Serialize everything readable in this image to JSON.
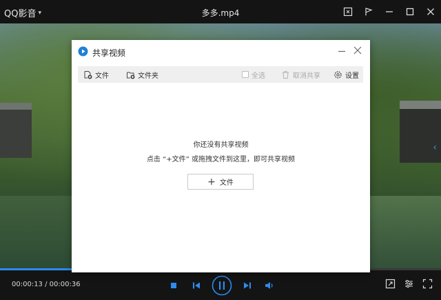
{
  "titlebar": {
    "app_name": "QQ影音",
    "file_title": "多多.mp4"
  },
  "player": {
    "current_time": "00:00:13",
    "total_time": "00:00:36",
    "time_separator": " / ",
    "progress_fraction": 0.36
  },
  "dialog": {
    "title": "共享视频",
    "toolbar": {
      "file_label": "文件",
      "folder_label": "文件夹",
      "select_all_label": "全选",
      "cancel_share_label": "取消共享",
      "settings_label": "设置"
    },
    "empty_title": "你还没有共享视频",
    "empty_hint": "点击 “+文件” 或拖拽文件到这里，即可共享视频",
    "add_file_label": "文件"
  },
  "colors": {
    "accent": "#2b8cf0",
    "titlebar_bg": "#141414",
    "toolbar_bg": "#efefef"
  }
}
